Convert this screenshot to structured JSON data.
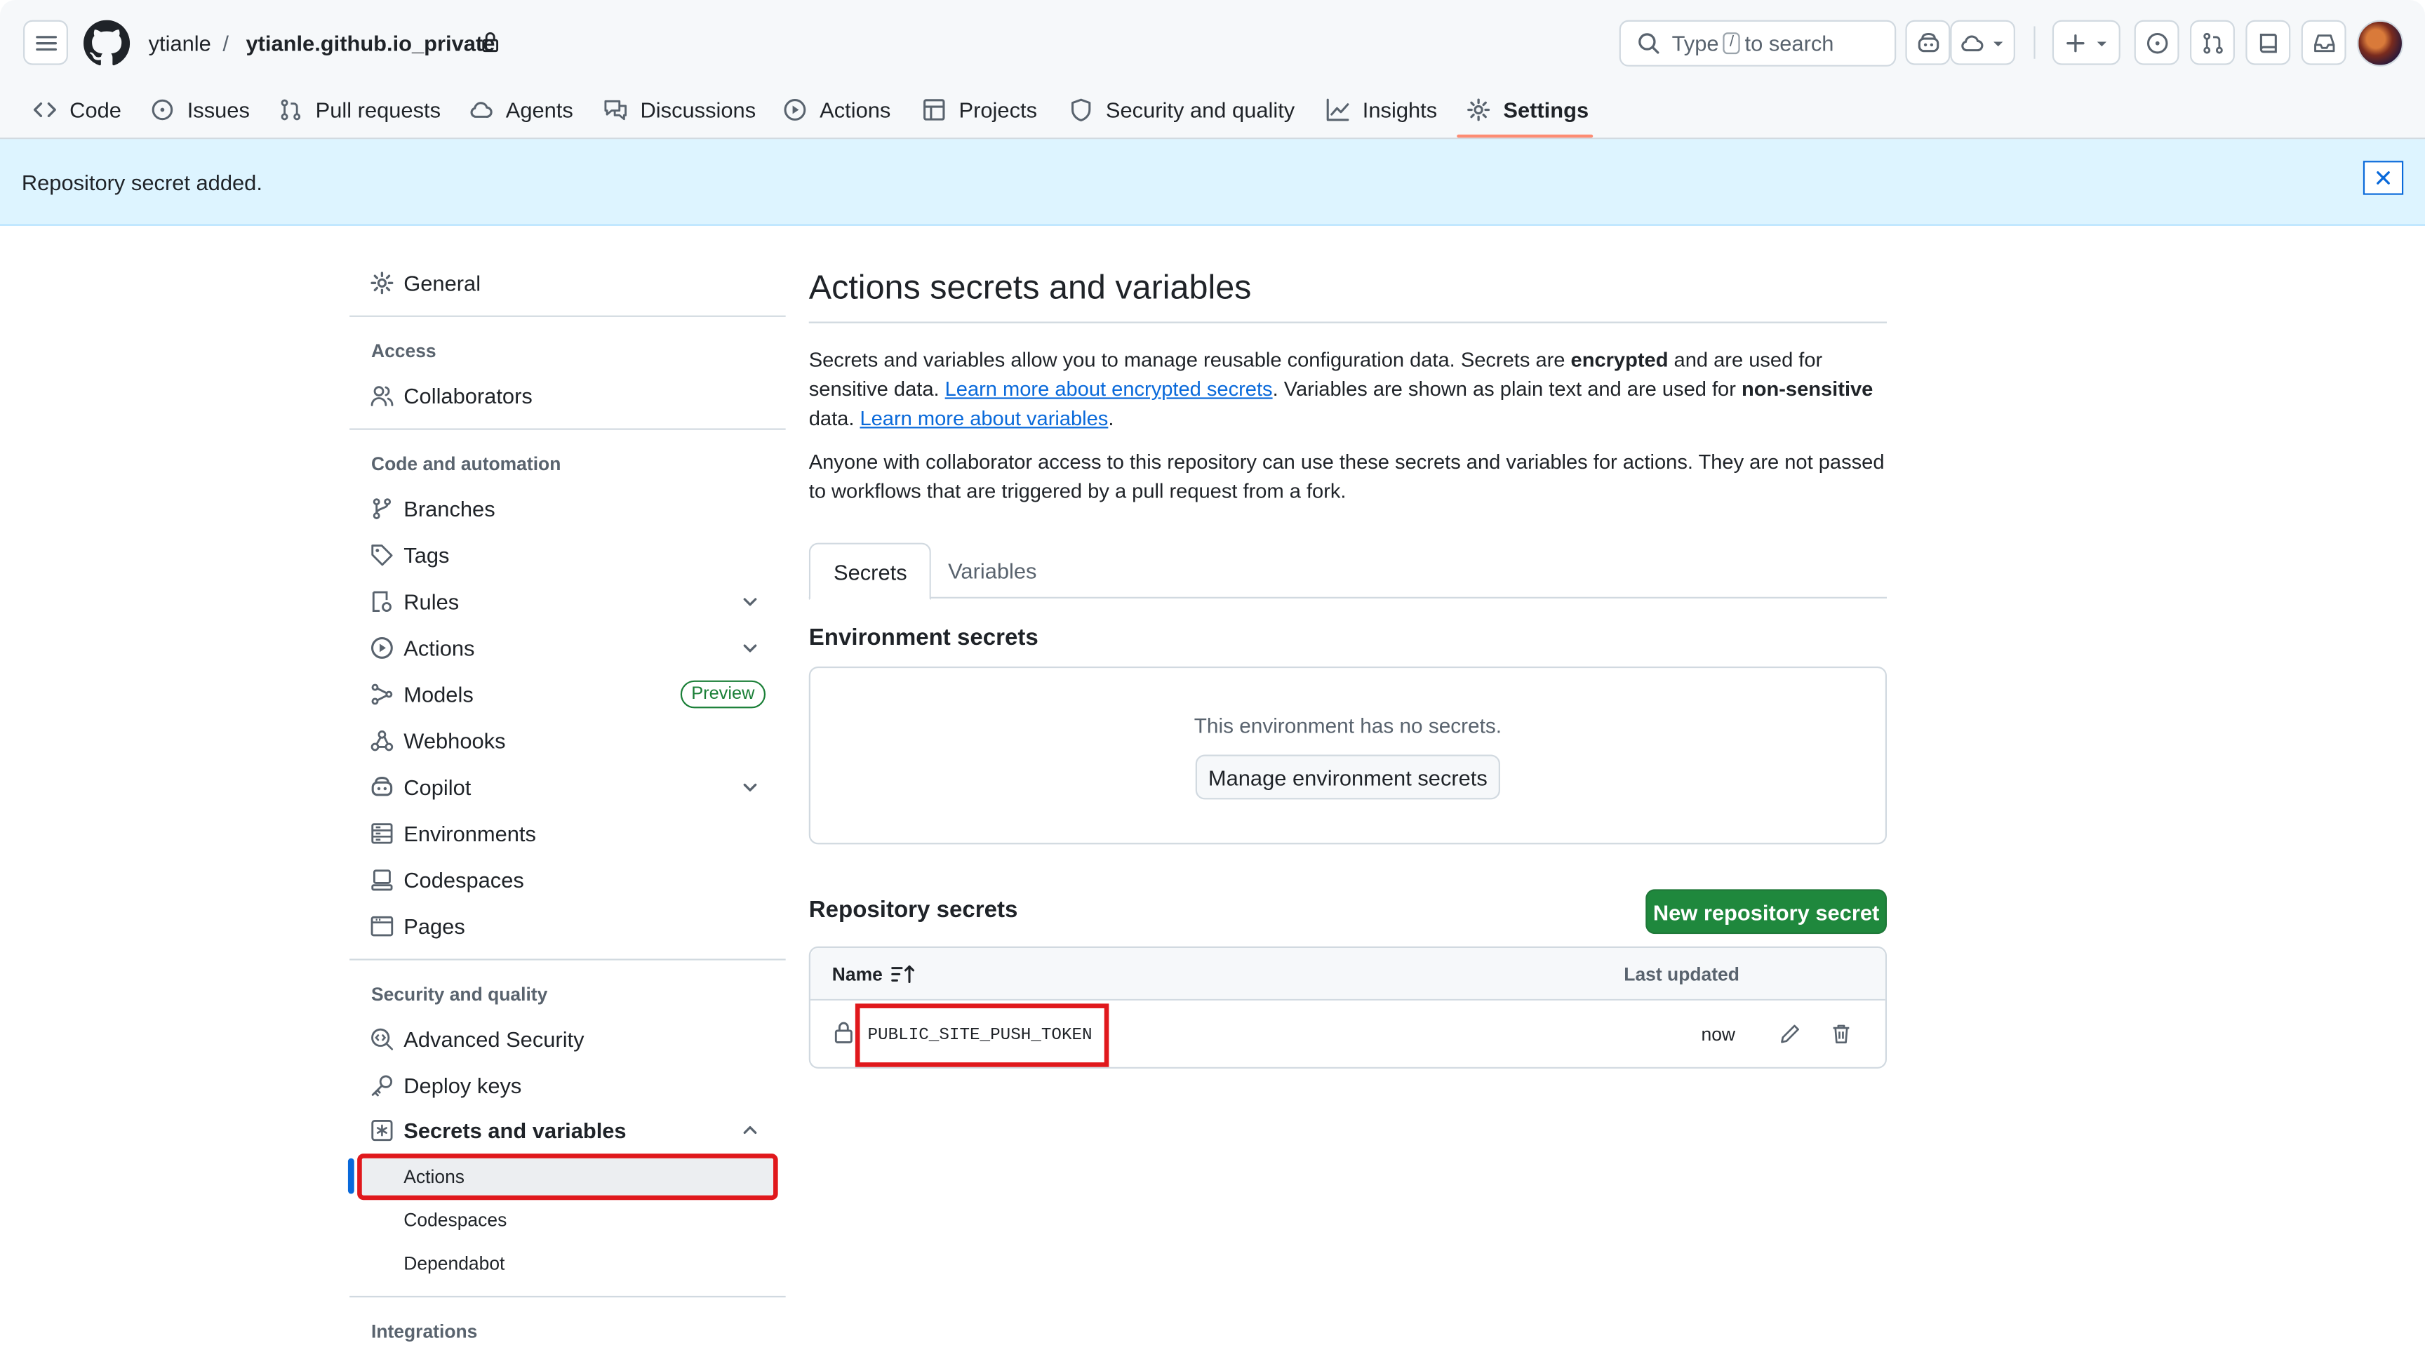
{
  "header": {
    "owner": "ytianle",
    "separator": "/",
    "repo": "ytianle.github.io_private",
    "search": {
      "prefix": "Type",
      "key": "/",
      "suffix": "to search"
    },
    "icons": [
      "menu-icon",
      "github-logo",
      "copilot-icon",
      "cloud-icon",
      "plus-icon",
      "issue-icon",
      "pull-request-icon",
      "book-icon",
      "inbox-icon"
    ]
  },
  "repo_nav": {
    "tabs": [
      {
        "label": "Code",
        "icon": "code-icon"
      },
      {
        "label": "Issues",
        "icon": "issue-icon"
      },
      {
        "label": "Pull requests",
        "icon": "pull-request-icon"
      },
      {
        "label": "Agents",
        "icon": "agents-icon"
      },
      {
        "label": "Discussions",
        "icon": "discussion-icon"
      },
      {
        "label": "Actions",
        "icon": "play-icon"
      },
      {
        "label": "Projects",
        "icon": "table-icon"
      },
      {
        "label": "Security and quality",
        "icon": "shield-icon"
      },
      {
        "label": "Insights",
        "icon": "graph-icon"
      },
      {
        "label": "Settings",
        "icon": "gear-icon",
        "selected": true
      }
    ]
  },
  "flash": {
    "message": "Repository secret added."
  },
  "sidebar": {
    "general": "General",
    "access_heading": "Access",
    "collaborators": "Collaborators",
    "code_heading": "Code and automation",
    "branches": "Branches",
    "tags": "Tags",
    "rules": "Rules",
    "actions": "Actions",
    "models": "Models",
    "models_badge": "Preview",
    "webhooks": "Webhooks",
    "copilot": "Copilot",
    "environments": "Environments",
    "codespaces": "Codespaces",
    "pages": "Pages",
    "security_heading": "Security and quality",
    "advanced_security": "Advanced Security",
    "deploy_keys": "Deploy keys",
    "secrets": "Secrets and variables",
    "sub_actions": "Actions",
    "sub_codespaces": "Codespaces",
    "sub_dependabot": "Dependabot",
    "integrations_heading": "Integrations"
  },
  "main": {
    "title": "Actions secrets and variables",
    "intro": {
      "t1": "Secrets and variables allow you to manage reusable configuration data. Secrets are ",
      "b1": "encrypted",
      "t2": " and are used for sensitive data. ",
      "link1": "Learn more about encrypted secrets",
      "t3": ". Variables are shown as plain text and are used for ",
      "b2": "non-sensitive",
      "t4": " data. ",
      "link2": "Learn more about variables",
      "t5": "."
    },
    "access_note": "Anyone with collaborator access to this repository can use these secrets and variables for actions. They are not passed to workflows that are triggered by a pull request from a fork.",
    "tabs": {
      "secrets": "Secrets",
      "variables": "Variables"
    },
    "env_secrets": {
      "heading": "Environment secrets",
      "empty_text": "This environment has no secrets.",
      "manage_button": "Manage environment secrets"
    },
    "repo_secrets": {
      "heading": "Repository secrets",
      "new_button": "New repository secret",
      "columns": {
        "name": "Name",
        "updated": "Last updated"
      },
      "rows": [
        {
          "name": "PUBLIC_SITE_PUSH_TOKEN",
          "updated": "now"
        }
      ]
    }
  },
  "colors": {
    "accent": "#0969da",
    "primary_button": "#1f883d",
    "flash_bg": "#ddf4ff",
    "highlight": "#e0181c",
    "tab_underline": "#fd8c73"
  }
}
